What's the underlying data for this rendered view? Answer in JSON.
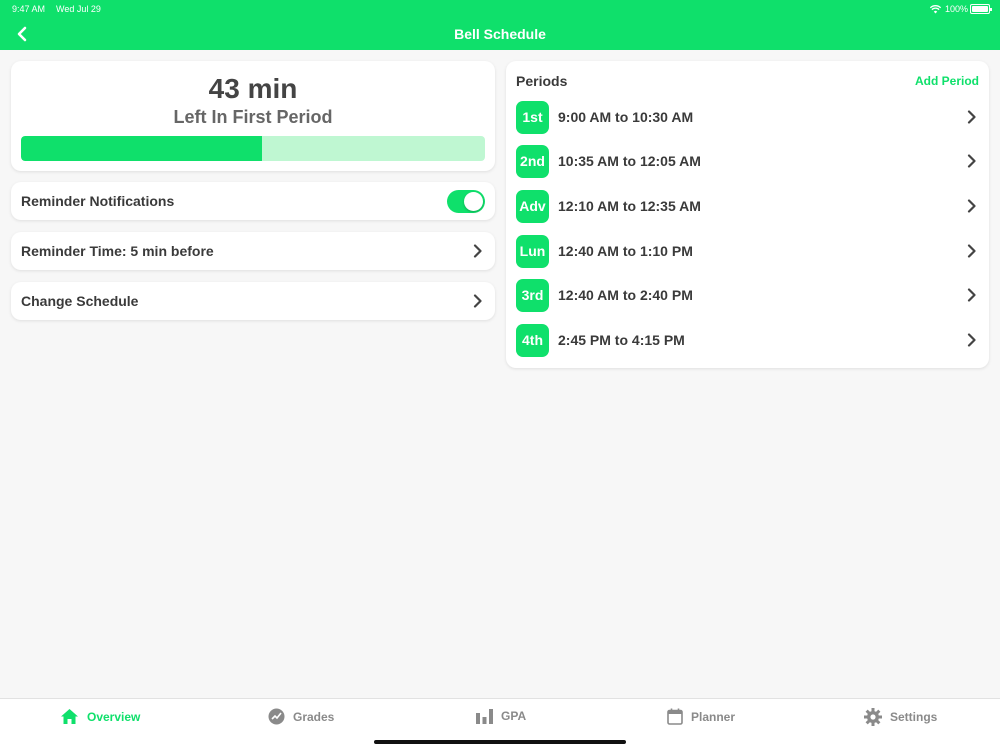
{
  "status": {
    "time": "9:47 AM",
    "date": "Wed Jul 29",
    "battery": "100%"
  },
  "nav": {
    "title": "Bell Schedule",
    "back_icon": "chevron-left-icon"
  },
  "countdown": {
    "minutes": "43 min",
    "label": "Left In First Period",
    "progress": 0.52
  },
  "settings": {
    "reminder_notifications": {
      "label": "Reminder Notifications",
      "enabled": true
    },
    "reminder_time": {
      "label": "Reminder Time: 5 min before"
    },
    "change_schedule": {
      "label": "Change Schedule"
    }
  },
  "periods": {
    "title": "Periods",
    "add_label": "Add Period",
    "items": [
      {
        "badge": "1st",
        "time": "9:00 AM to 10:30 AM"
      },
      {
        "badge": "2nd",
        "time": "10:35 AM to 12:05 AM"
      },
      {
        "badge": "Adv",
        "time": "12:10 AM to 12:35 AM"
      },
      {
        "badge": "Lun",
        "time": "12:40 AM to 1:10 PM"
      },
      {
        "badge": "3rd",
        "time": "12:40 AM to 2:40 PM"
      },
      {
        "badge": "4th",
        "time": "2:45 PM to 4:15 PM"
      }
    ]
  },
  "tabs": [
    {
      "label": "Overview",
      "icon": "home-icon",
      "active": true
    },
    {
      "label": "Grades",
      "icon": "grades-icon",
      "active": false
    },
    {
      "label": "GPA",
      "icon": "bar-chart-icon",
      "active": false
    },
    {
      "label": "Planner",
      "icon": "calendar-icon",
      "active": false
    },
    {
      "label": "Settings",
      "icon": "gear-icon",
      "active": false
    }
  ],
  "colors": {
    "accent": "#0fe06b",
    "accent_light": "#bff7d2",
    "background": "#f7f7f7"
  }
}
